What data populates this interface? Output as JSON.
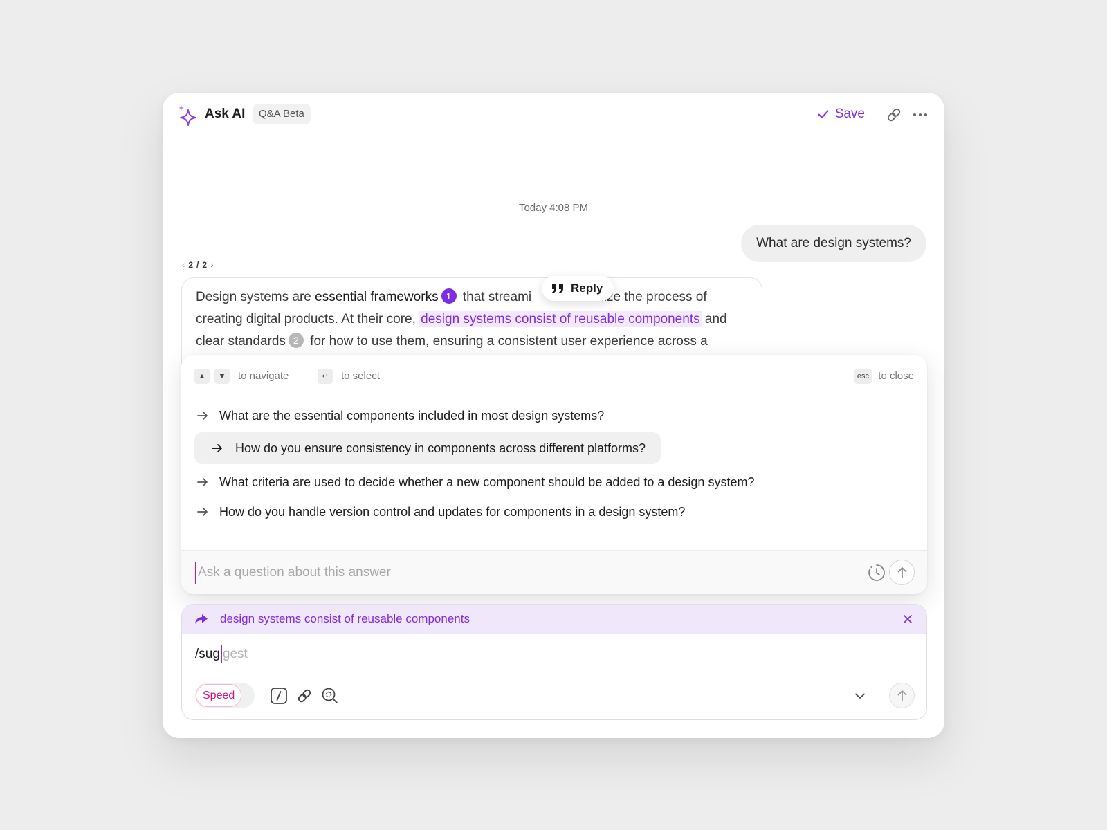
{
  "header": {
    "logo_icon": "sparkle-icon",
    "title": "Ask AI",
    "badge": "Q&A Beta",
    "save_label": "Save",
    "link_icon": "link-icon",
    "more_icon": "more-horizontal-icon"
  },
  "conversation": {
    "timestamp": "Today 4:08 PM",
    "user_message": "What are design systems?",
    "pager": {
      "current": "2",
      "sep": "/",
      "total": "2"
    },
    "answer": {
      "p1": "Design systems are ",
      "bold1": "essential frameworks",
      "cite1": "1",
      "p2": " that streami",
      "p3": "ndardize the process of creating digital products. At their core, ",
      "highlight": "design systems consist of reusable components",
      "p4": " and clear standards",
      "cite2": "2",
      "p5": " for how to use them, ensuring a consistent user experience across a"
    },
    "reply_label": "Reply"
  },
  "suggestions": {
    "hints": {
      "up_key": "▲",
      "down_key": "▼",
      "navigate": "to navigate",
      "enter_key": "↵",
      "select": "to select",
      "esc_key": "esc",
      "close": "to close"
    },
    "items": [
      {
        "text": "What are the essential components included in most design systems?",
        "active": false
      },
      {
        "text": "How do you ensure consistency in components across different platforms?",
        "active": true
      },
      {
        "text": "What criteria are used to decide whether a new component should be added to a design system?",
        "active": false
      },
      {
        "text": "How do you handle version control and updates for components in a design system?",
        "active": false
      }
    ],
    "input_placeholder": "Ask a question about this answer",
    "input_value": ""
  },
  "composer": {
    "quote_text": "design systems consist of reusable components",
    "typed": "/sug",
    "ghost_completion": "gest",
    "mode_label": "Speed",
    "tools": [
      "slash-command-icon",
      "link-icon",
      "search-zoom-icon"
    ]
  },
  "colors": {
    "accent": "#7c2ee0",
    "highlight_bg": "#f3e8fd",
    "mode_pink": "#d4117f",
    "page_bg": "#ededed"
  }
}
